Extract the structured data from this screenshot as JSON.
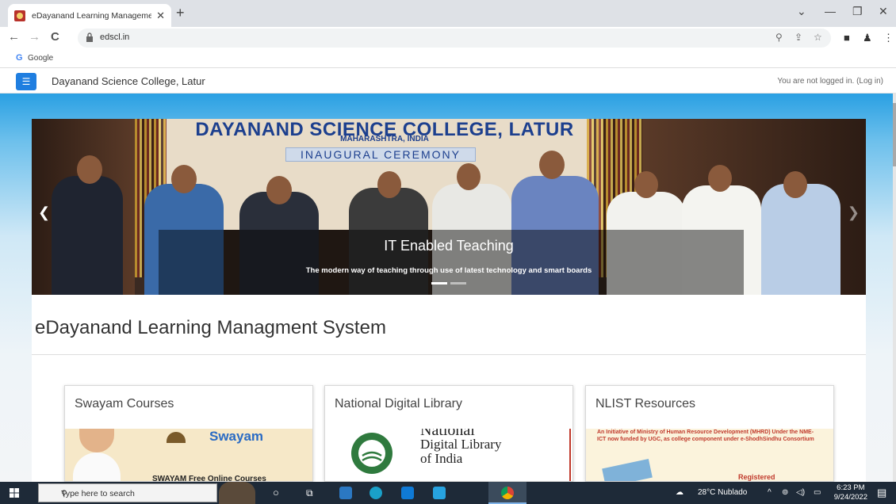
{
  "browser": {
    "tab_title": "eDayanand Learning Managemen",
    "url": "edscl.in",
    "bookmark_label": "Google"
  },
  "navbar": {
    "site_name": "Dayanand Science College, Latur",
    "login_status": "You are not logged in.",
    "login_link": "(Log in)"
  },
  "carousel": {
    "banner_title": "DAYANAND SCIENCE COLLEGE, LATUR",
    "banner_subtitle": "MAHARASHTRA, INDIA",
    "banner_ceremony": "INAUGURAL CEREMONY",
    "caption_title": "IT Enabled Teaching",
    "caption_text": "The modern way of teaching through use of latest technology and smart boards"
  },
  "page": {
    "heading": "eDayanand Learning Managment System"
  },
  "cards": [
    {
      "title": "Swayam Courses",
      "image_text": "Swayam",
      "image_sub": "SWAYAM Free Online Courses"
    },
    {
      "title": "National Digital Library",
      "image_text": "National",
      "image_sub": "Digital Library",
      "image_sub2": "of India"
    },
    {
      "title": "NLIST Resources",
      "image_text": "An Initiative of Ministry of Human Resource Development (MHRD) Under the NME-ICT now funded by UGC, as college component under e-ShodhSindhu Consortium",
      "image_sub": "Registered"
    }
  ],
  "taskbar": {
    "search_placeholder": "Type here to search",
    "weather": "28°C Nublado",
    "time": "6:23 PM",
    "date": "9/24/2022"
  },
  "colors": {
    "accent": "#1f7ee0",
    "taskbar": "#1e2a38"
  }
}
